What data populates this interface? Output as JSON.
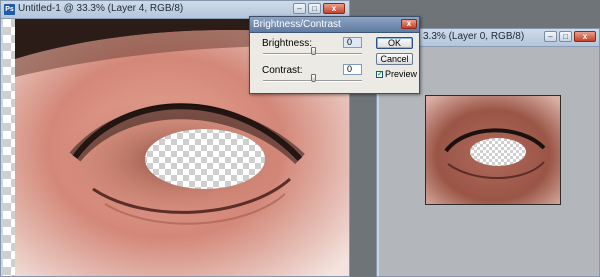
{
  "doc1": {
    "title": "Untitled-1 @ 33.3% (Layer 4, RGB/8)",
    "icon": "Ps"
  },
  "doc2": {
    "title": "3.3% (Layer 0, RGB/8)",
    "icon": "Ps"
  },
  "window_buttons": {
    "minimize": "–",
    "maximize": "□",
    "close": "x"
  },
  "dialog": {
    "title": "Brightness/Contrast",
    "brightness_label": "Brightness:",
    "brightness_value": "0",
    "brightness_level": 0,
    "contrast_label": "Contrast:",
    "contrast_value": "0",
    "contrast_level": 0,
    "ok_label": "OK",
    "cancel_label": "Cancel",
    "preview_label": "Preview",
    "preview_checked": true,
    "close_glyph": "x"
  },
  "icons": [
    "photoshop-doc-icon",
    "minimize-icon",
    "maximize-icon",
    "close-icon",
    "slider-thumb-icon",
    "checkbox-check-icon"
  ],
  "colors": {
    "dialog_title": "#5f7ba3",
    "window_title": "#b4c6dc",
    "workspace": "#6f7478"
  }
}
